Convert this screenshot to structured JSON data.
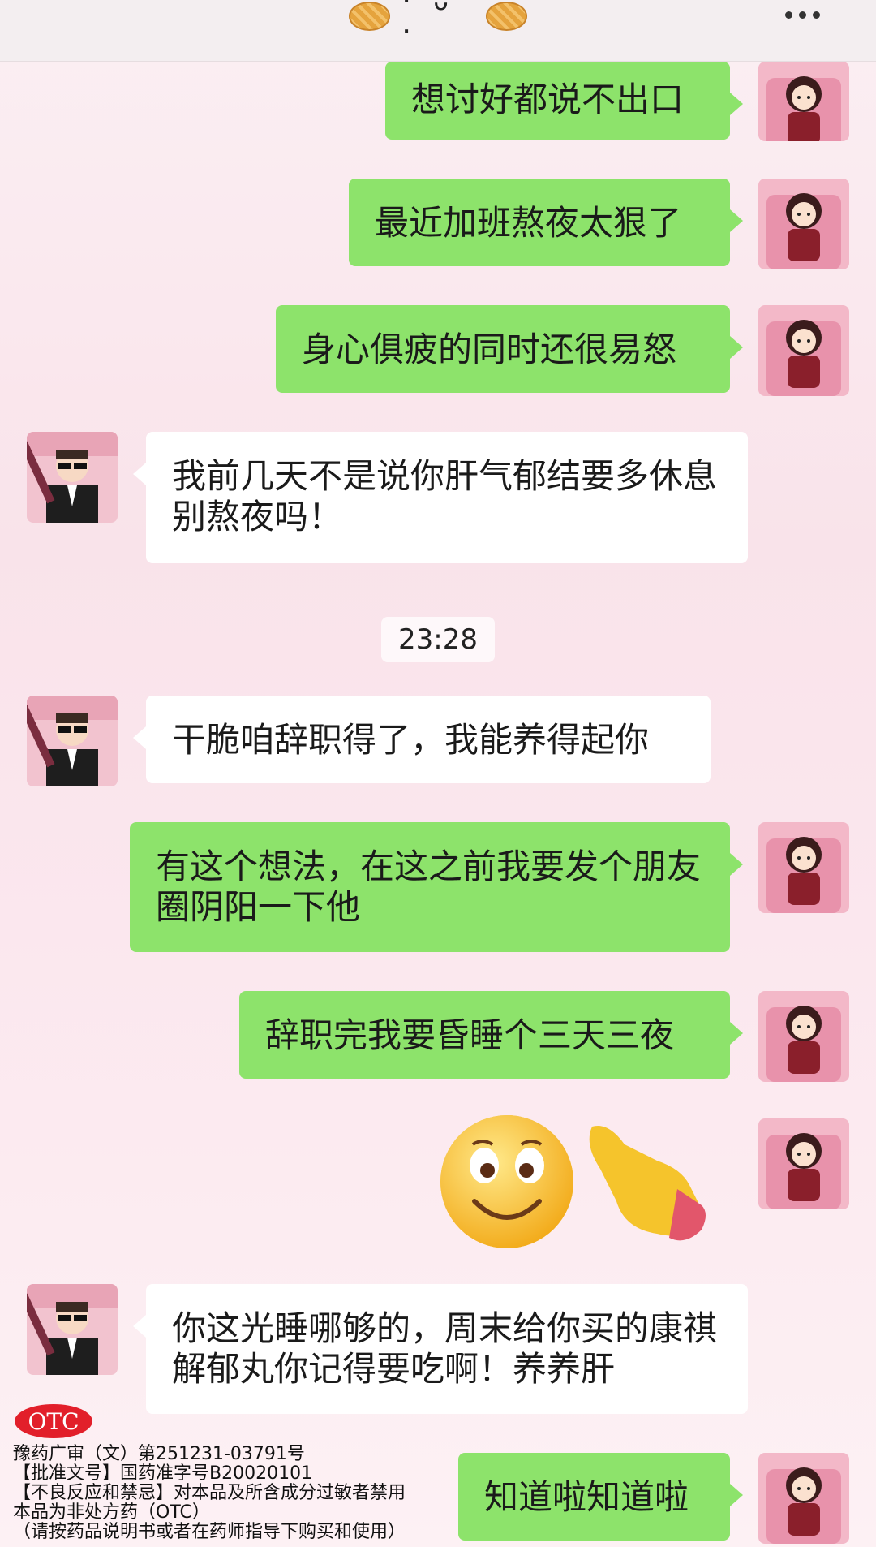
{
  "header": {
    "title_face": "· ᴗ ·",
    "title_left_icon": "waffle-emoji",
    "title_right_icon": "waffle-emoji",
    "more_icon": "more-dots-icon"
  },
  "messages": [
    {
      "side": "right",
      "text": "想讨好都说不出口"
    },
    {
      "side": "right",
      "text": "最近加班熬夜太狠了"
    },
    {
      "side": "right",
      "text": "身心俱疲的同时还很易怒"
    },
    {
      "side": "left",
      "text": "我前几天不是说你肝气郁结要多休息别熬夜吗！"
    },
    {
      "side": "left",
      "text": "干脆咱辞职得了，我能养得起你"
    },
    {
      "side": "right",
      "text": "有这个想法，在这之前我要发个朋友圈阴阳一下他"
    },
    {
      "side": "right",
      "text": "辞职完我要昏睡个三天三夜"
    },
    {
      "side": "left",
      "text": "你这光睡哪够的，周末给你买的康祺解郁丸你记得要吃啊！养养肝"
    },
    {
      "side": "right",
      "text": "知道啦知道啦"
    }
  ],
  "timestamp": "23:28",
  "stickers": [
    "smiley-emoji",
    "pointing-hand-emoji"
  ],
  "ad": {
    "badge": "OTC",
    "lines": [
      "豫药广审（文）第251231-03791号",
      "【批准文号】国药准字号B20020101",
      "【不良反应和禁忌】对本品及所含成分过敏者禁用",
      "本品为非处方药（OTC）",
      "（请按药品说明书或者在药师指导下购买和使用）"
    ]
  },
  "colors": {
    "outgoing_bubble": "#8de36b",
    "incoming_bubble": "#ffffff",
    "otc_red": "#e21f2a"
  }
}
